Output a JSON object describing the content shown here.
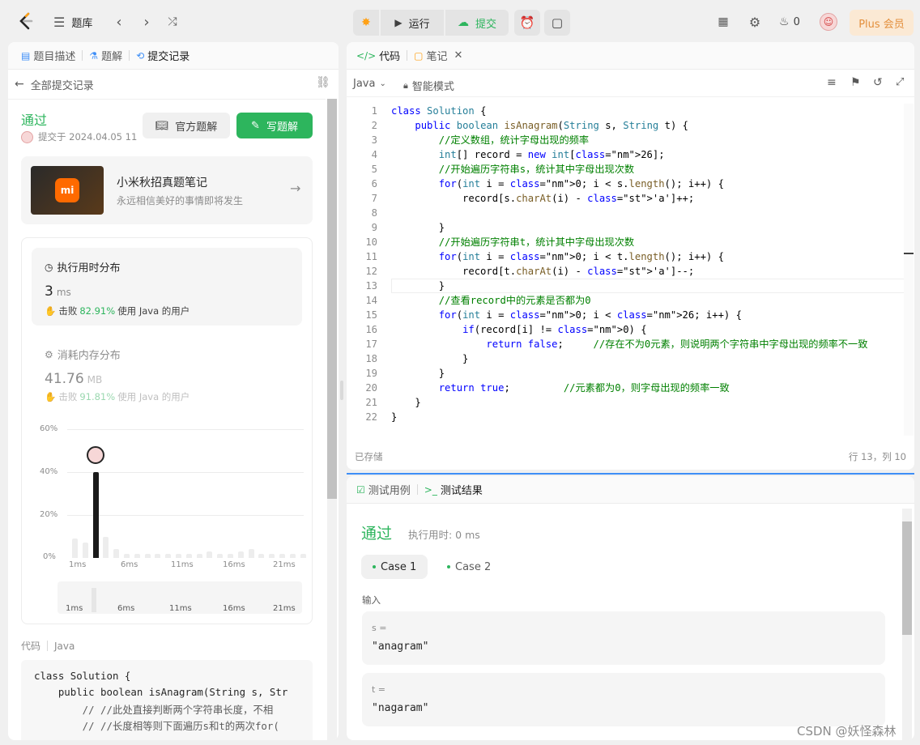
{
  "topbar": {
    "problem_bank": "题库",
    "run_label": "运行",
    "submit_label": "提交",
    "streak_count": "0",
    "plus_label": "Plus 会员"
  },
  "left": {
    "tabs": [
      {
        "label": "题目描述"
      },
      {
        "label": "题解"
      },
      {
        "label": "提交记录"
      }
    ],
    "back_label": "全部提交记录",
    "status": "通过",
    "submitted_at": "提交于 2024.04.05 11",
    "official_solution": "官方题解",
    "write_solution": "写题解",
    "promo": {
      "title": "小米秋招真题笔记",
      "subtitle": "永远相信美好的事情即将发生",
      "logo": "mi"
    },
    "runtime": {
      "title": "执行用时分布",
      "value": "3",
      "unit": "ms",
      "beats_prefix": "击败",
      "beats_pct": "82.91%",
      "beats_suffix": "使用 Java 的用户"
    },
    "memory": {
      "title": "消耗内存分布",
      "value": "41.76",
      "unit": "MB",
      "beats_prefix": "击败",
      "beats_pct": "91.81%",
      "beats_suffix": "使用 Java 的用户"
    },
    "chart_data": {
      "type": "bar",
      "ylabel": "",
      "xlabel": "",
      "y_ticks": [
        "60%",
        "40%",
        "20%",
        "0%"
      ],
      "x_ticks": [
        "1ms",
        "6ms",
        "11ms",
        "16ms",
        "21ms"
      ],
      "ylim": [
        0,
        60
      ],
      "highlight_index": 2,
      "values": [
        9,
        7,
        40,
        10,
        4,
        2,
        2,
        2,
        2,
        2,
        2,
        2,
        2,
        3,
        2,
        2,
        3,
        4,
        2,
        2,
        2,
        2,
        2
      ]
    },
    "mini_ticks": [
      "1ms",
      "6ms",
      "11ms",
      "16ms",
      "21ms"
    ],
    "code_header": {
      "label": "代码",
      "lang": "Java"
    },
    "code_preview": [
      "class Solution {",
      "    public boolean isAnagram(String s, Str",
      "        // //此处直接判断两个字符串长度，不相",
      "        // //长度相等则下面遍历s和t的两次for("
    ]
  },
  "editor": {
    "tab_code": "代码",
    "tab_notes": "笔记",
    "lang": "Java",
    "mode": "智能模式",
    "saved": "已存储",
    "cursor": "行 13，列 10",
    "lines": [
      "class Solution {",
      "    public boolean isAnagram(String s, String t) {",
      "        //定义数组，统计字母出现的频率",
      "        int[] record = new int[26];",
      "        //开始遍历字符串s，统计其中字母出现次数",
      "        for(int i = 0; i < s.length(); i++) {",
      "            record[s.charAt(i) - 'a']++;",
      "",
      "        }",
      "        //开始遍历字符串t，统计其中字母出现次数",
      "        for(int i = 0; i < t.length(); i++) {",
      "            record[t.charAt(i) - 'a']--;",
      "        }",
      "        //查看record中的元素是否都为0",
      "        for(int i = 0; i < 26; i++) {",
      "            if(record[i] != 0) {",
      "                return false;     //存在不为0元素，则说明两个字符串中字母出现的频率不一致",
      "            }",
      "        }",
      "        return true;         //元素都为0，则字母出现的频率一致",
      "    }",
      "}"
    ]
  },
  "result": {
    "tab_testcase": "测试用例",
    "tab_result": "测试结果",
    "status": "通过",
    "runtime": "执行用时: 0 ms",
    "cases": [
      "Case 1",
      "Case 2"
    ],
    "input_label": "输入",
    "inputs": [
      {
        "name": "s =",
        "value": "\"anagram\""
      },
      {
        "name": "t =",
        "value": "\"nagaram\""
      }
    ]
  },
  "watermark": "CSDN @妖怪森林",
  "colors": {
    "accent_green": "#2db55d",
    "plus_bg": "#fbe9d4",
    "plus_text": "#e38f3c"
  }
}
